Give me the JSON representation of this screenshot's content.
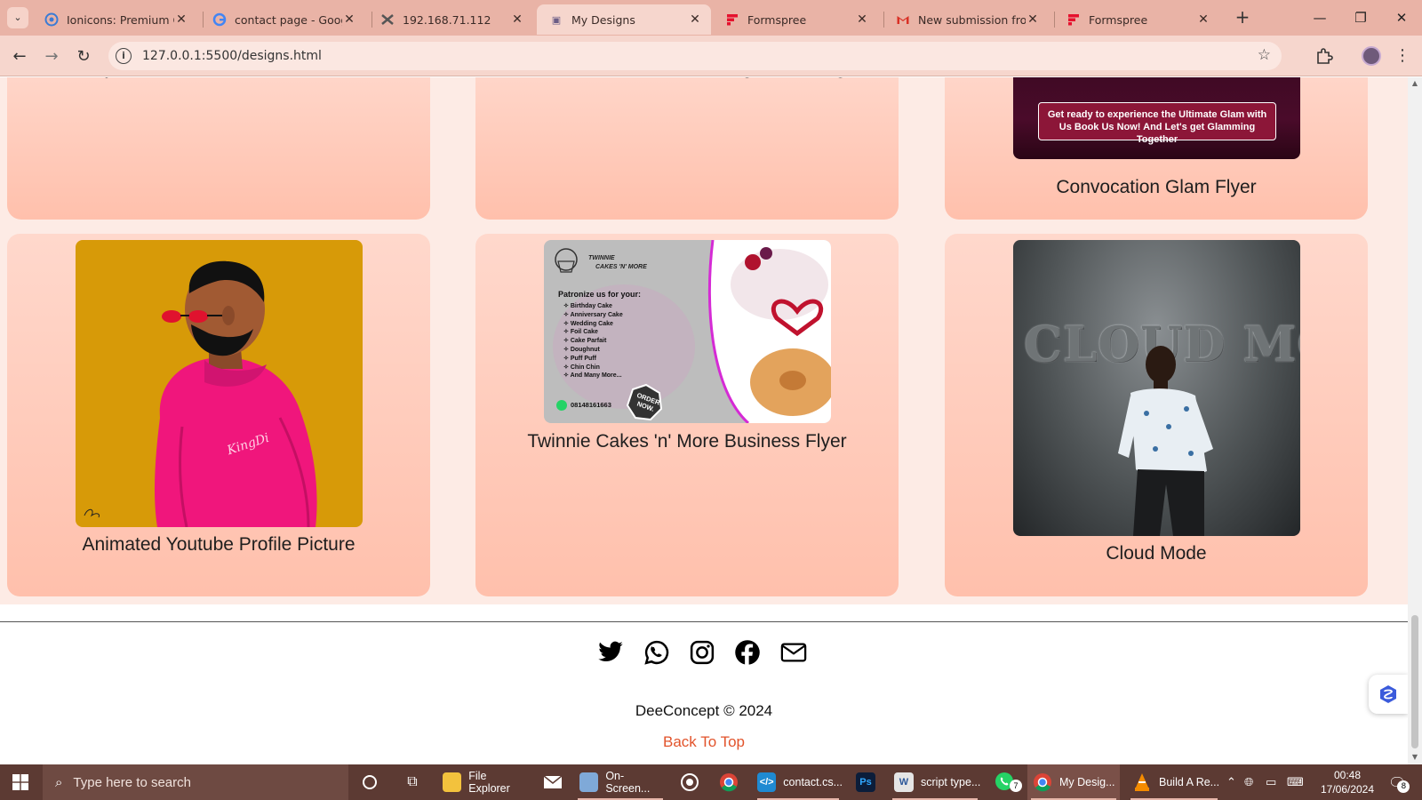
{
  "browser": {
    "tabs": [
      {
        "title": "Ionicons: Premium Open",
        "favicon": "ionicons-icon",
        "active": false
      },
      {
        "title": "contact page - Google",
        "favicon": "google-icon",
        "active": false
      },
      {
        "title": "192.168.71.112",
        "favicon": "xampp-icon",
        "active": false
      },
      {
        "title": "My Designs",
        "favicon": "page-icon",
        "active": true
      },
      {
        "title": "Formspree",
        "favicon": "formspree-icon",
        "active": false
      },
      {
        "title": "New submission from",
        "favicon": "gmail-icon",
        "active": false
      },
      {
        "title": "Formspree",
        "favicon": "formspree-icon",
        "active": false
      }
    ],
    "url": "127.0.0.1:5500/designs.html"
  },
  "gallery": {
    "top_row": [
      {
        "caption": "",
        "clipped_text": "y"
      },
      {
        "caption": "",
        "clipped_text": "g                g"
      },
      {
        "caption": "Convocation Glam Flyer",
        "clipped_text": "",
        "image_text": "Get ready to experience the Ultimate Glam with Us Book Us Now! And Let's get Glamming Together"
      }
    ],
    "bottom_row": [
      {
        "caption": "Animated Youtube Profile Picture",
        "image_text": "KingDi"
      },
      {
        "caption": "Twinnie Cakes 'n' More Business Flyer"
      },
      {
        "caption": "Cloud Mode",
        "image_text": "CLOUD MODE"
      }
    ]
  },
  "flyer": {
    "brand_line1": "TWINNIE",
    "brand_line2": "CAKES 'N' MORE",
    "heading": "Patronize us for your:",
    "items": [
      "Birthday Cake",
      "Anniversary Cake",
      "Wedding Cake",
      "Foil Cake",
      "Cake Parfait",
      "Doughnut",
      "Puff Puff",
      "Chin Chin",
      "And Many More..."
    ],
    "phone": "08148161663",
    "badge_line1": "ORDER",
    "badge_line2": "NOW."
  },
  "footer": {
    "social": [
      "twitter-icon",
      "whatsapp-icon",
      "instagram-icon",
      "facebook-icon",
      "mail-icon"
    ],
    "copyright": "DeeConcept © 2024",
    "back_to_top": "Back To Top"
  },
  "taskbar": {
    "search_placeholder": "Type here to search",
    "items": [
      {
        "label": "File Explorer",
        "icon": "folder-icon"
      },
      {
        "label": "",
        "icon": "mail-icon"
      },
      {
        "label": "On-Screen...",
        "icon": "keyboard-icon"
      },
      {
        "label": "",
        "icon": "obs-icon"
      },
      {
        "label": "",
        "icon": "chrome-icon"
      },
      {
        "label": "contact.cs...",
        "icon": "vscode-icon"
      },
      {
        "label": "",
        "icon": "photoshop-icon"
      },
      {
        "label": "script type...",
        "icon": "word-icon"
      },
      {
        "label": "",
        "icon": "whatsapp-icon",
        "badge": "7"
      },
      {
        "label": "My Desig...",
        "icon": "chrome-icon",
        "active": true
      },
      {
        "label": "Build A Re...",
        "icon": "vlc-icon"
      }
    ],
    "time": "00:48",
    "date": "17/06/2024",
    "notification_count": "8"
  }
}
